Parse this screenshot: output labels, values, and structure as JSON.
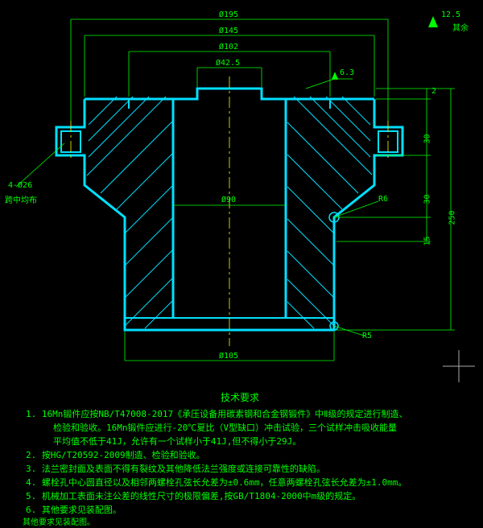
{
  "dimensions": {
    "d195": "Ø195",
    "d145": "Ø145",
    "d102": "Ø102",
    "d42_5": "Ø42.5",
    "d90": "Ø90",
    "d105": "Ø105",
    "hole": "4-Ø26",
    "hole_note": "跨中均布",
    "r6": "R6",
    "r5": "R5",
    "h2": "2",
    "h30a": "30",
    "h30b": "30",
    "h15": "15",
    "h250": "250"
  },
  "surface": {
    "sf1": "6.3",
    "sf_default": "12.5",
    "sf_rest": "其余"
  },
  "requirements": {
    "title": "技术要求",
    "r1": "1. 16Mn锻件应按NB/T47008-2017《承压设备用碳素钢和合金钢锻件》中Ⅱ级的规定进行制造、",
    "r1b": "检验和验收。16Mn锻件应进行-20℃夏比（V型缺口）冲击试验，三个试样冲击吸收能量",
    "r1c": "平均值不低于41J，允许有一个试样小于41J,但不得小于29J。",
    "r2": "2. 按HG/T20592-2009制造、检验和验收。",
    "r3": "3. 法兰密封面及表面不得有裂纹及其他降低法兰强度或连接可靠性的缺陷。",
    "r4": "4. 螺栓孔中心圆直径以及相邻两螺栓孔弦长允差为±0.6mm，任意两螺栓孔弦长允差为±1.0mm。",
    "r5": "5. 机械加工表面未注公差的线性尺寸的极限偏差,按GB/T1804-2000中m级的规定。",
    "r6": "6. 其他要求见装配图。"
  },
  "bottom_tag": "其他要求见装配图。"
}
